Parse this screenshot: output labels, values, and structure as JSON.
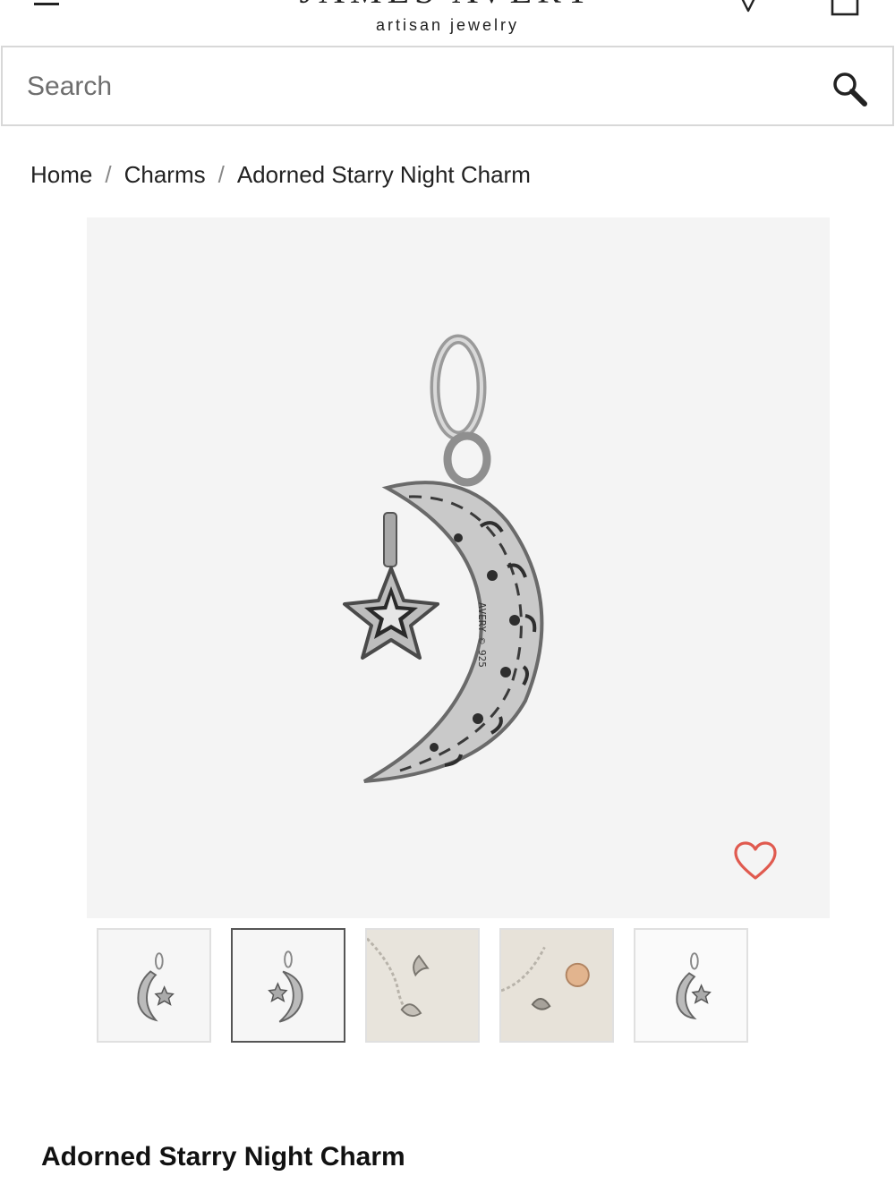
{
  "header": {
    "logo_main": "JAMES AVERY",
    "logo_sub": "artisan jewelry",
    "icons": [
      "menu-icon",
      "location-pin-icon",
      "shopping-bag-icon"
    ]
  },
  "search": {
    "placeholder": "Search",
    "icon": "search-icon"
  },
  "breadcrumb": {
    "items": [
      {
        "label": "Home"
      },
      {
        "label": "Charms"
      },
      {
        "label": "Adorned Starry Night Charm"
      }
    ],
    "separator": "/"
  },
  "product": {
    "title": "Adorned Starry Night Charm",
    "image_engraving": "AVERY © 925",
    "favorite_icon": "heart-icon",
    "thumbnails": [
      {
        "name": "thumb-front-view",
        "selected": false
      },
      {
        "name": "thumb-back-view",
        "selected": true
      },
      {
        "name": "thumb-bracelet-view",
        "selected": false
      },
      {
        "name": "thumb-gold-bracelet-view",
        "selected": false
      },
      {
        "name": "thumb-detail-view",
        "selected": false
      }
    ]
  },
  "colors": {
    "heart": "#e05a4f",
    "image_background": "#f4f4f4",
    "selected_thumb_border": "#555555"
  }
}
